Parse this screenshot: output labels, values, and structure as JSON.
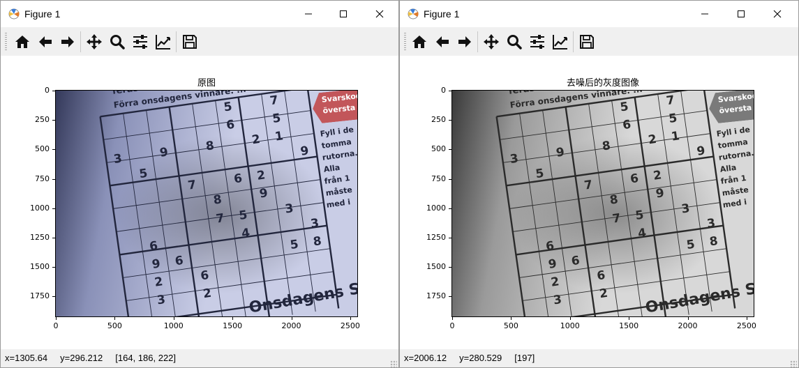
{
  "windows": [
    {
      "id": "left",
      "title": "Figure 1",
      "axes_title": "原图",
      "status": "x=1305.64     y=296.212     [164, 186, 222]",
      "color_mode": "color",
      "y_ticks": [
        "0",
        "250",
        "500",
        "750",
        "1000",
        "1250",
        "1500",
        "1750"
      ],
      "x_ticks": [
        "0",
        "500",
        "1000",
        "1500",
        "2000",
        "2500"
      ]
    },
    {
      "id": "right",
      "title": "Figure 1",
      "axes_title": "去噪后的灰度图像",
      "status": "x=2006.12     y=280.529     [197]",
      "color_mode": "gray",
      "y_ticks": [
        "0",
        "250",
        "500",
        "750",
        "1000",
        "1250",
        "1500",
        "1750"
      ],
      "x_ticks": [
        "0",
        "500",
        "1000",
        "1500",
        "2000",
        "2500"
      ]
    }
  ],
  "toolbar_icons": [
    "home-icon",
    "back-icon",
    "forward-icon",
    "pan-icon",
    "zoom-icon",
    "configure-subplots-icon",
    "edit-curve-icon",
    "save-icon"
  ],
  "photo": {
    "header_lines": [
      "feras",
      "Förra onsdagens vinnare: ..."
    ],
    "banner": [
      "Svarskod",
      "översta ra"
    ],
    "side_text": [
      "Fyll i de",
      "tomma",
      "rutorna.",
      "Alla",
      "från 1",
      "måste",
      "med i"
    ],
    "bottom_text": "Onsdagens S",
    "digits": [
      {
        "r": 0,
        "c": 5,
        "v": "5"
      },
      {
        "r": 0,
        "c": 7,
        "v": "7"
      },
      {
        "r": 1,
        "c": 5,
        "v": "6"
      },
      {
        "r": 1,
        "c": 7,
        "v": "5"
      },
      {
        "r": 2,
        "c": 0,
        "v": "3"
      },
      {
        "r": 2,
        "c": 2,
        "v": "9"
      },
      {
        "r": 2,
        "c": 4,
        "v": "8"
      },
      {
        "r": 2,
        "c": 6,
        "v": "2"
      },
      {
        "r": 2,
        "c": 7,
        "v": "1"
      },
      {
        "r": 3,
        "c": 1,
        "v": "5"
      },
      {
        "r": 3,
        "c": 8,
        "v": "9"
      },
      {
        "r": 4,
        "c": 3,
        "v": "7"
      },
      {
        "r": 4,
        "c": 5,
        "v": "6"
      },
      {
        "r": 4,
        "c": 6,
        "v": "2"
      },
      {
        "r": 5,
        "c": 4,
        "v": "8"
      },
      {
        "r": 5,
        "c": 6,
        "v": "9"
      },
      {
        "r": 6,
        "c": 4,
        "v": "7"
      },
      {
        "r": 6,
        "c": 5,
        "v": "5"
      },
      {
        "r": 6,
        "c": 7,
        "v": "3"
      },
      {
        "r": 7,
        "c": 1,
        "v": "6"
      },
      {
        "r": 7,
        "c": 8,
        "v": "3"
      },
      {
        "r": 7,
        "c": 5,
        "v": "4"
      },
      {
        "r": 8,
        "c": 1,
        "v": "9"
      },
      {
        "r": 8,
        "c": 2,
        "v": "6"
      },
      {
        "r": 8,
        "c": 7,
        "v": "5"
      },
      {
        "r": 8,
        "c": 8,
        "v": "8"
      }
    ],
    "digits_lower": [
      {
        "r": 9,
        "c": 1,
        "v": "2"
      },
      {
        "r": 9,
        "c": 3,
        "v": "6"
      },
      {
        "r": 10,
        "c": 1,
        "v": "3"
      },
      {
        "r": 10,
        "c": 3,
        "v": "2"
      }
    ]
  }
}
